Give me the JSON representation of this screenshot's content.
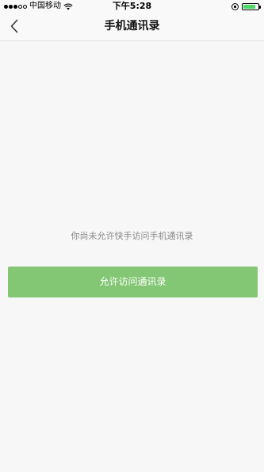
{
  "status_bar": {
    "carrier": "中国移动",
    "time": "下午5:28",
    "battery_level": 0.85,
    "icons": [
      "signal-icon",
      "wifi-icon",
      "orientation-lock-icon",
      "battery-icon"
    ]
  },
  "nav": {
    "title": "手机通讯录",
    "back_icon": "chevron-left-icon"
  },
  "main": {
    "notice": "你尚未允许快手访问手机通讯录",
    "allow_button_label": "允许访问通讯录"
  },
  "colors": {
    "accent": "#83c774",
    "background": "#f7f7f7",
    "notice_text": "#888888"
  }
}
